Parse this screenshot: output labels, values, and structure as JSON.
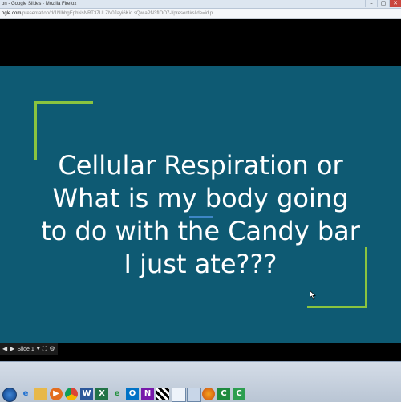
{
  "window": {
    "title": "on - Google Slides - Mozilla Firefox",
    "controls": {
      "minimize": "–",
      "maximize": "▢",
      "close": "✕"
    }
  },
  "urlbar": {
    "host": "ogle.com",
    "path": "/presentation/d/1NlhbgEphNsNRT37ULZN0Jayi6Kid.sQwlaPN3fIOO7-l/present#slide=id.p"
  },
  "slide": {
    "title_lines": [
      "Cellular Respiration or",
      "What is my body going",
      "to do with the Candy bar",
      "I just ate???"
    ],
    "colors": {
      "background": "#0e5a73",
      "bracket": "#8ac43f",
      "accent": "#3d86c6"
    }
  },
  "present_controls": {
    "slide_selector": "Slide 1"
  },
  "taskbar": {
    "icons": [
      "start-orb",
      "ie-icon",
      "folder-icon",
      "media-player-icon",
      "chrome-icon",
      "word-icon",
      "excel-icon",
      "edu-icon",
      "outlook-icon",
      "onenote-icon",
      "crossword-icon",
      "window-icon",
      "browser-icon",
      "firefox-icon",
      "camtasia-icon",
      "camtasia-recorder-icon"
    ]
  }
}
